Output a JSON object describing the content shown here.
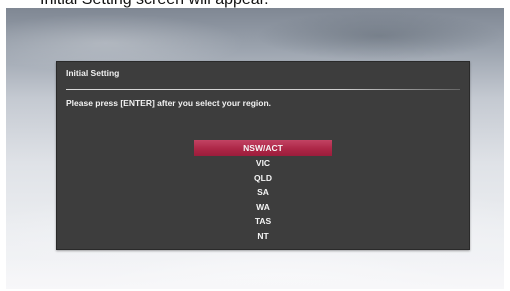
{
  "top_caption": "Initial Setting screen will appear.",
  "dialog": {
    "title": "Initial Setting",
    "instruction": "Please press [ENTER] after you select your region."
  },
  "regions": [
    {
      "label": "NSW/ACT",
      "selected": true
    },
    {
      "label": "VIC",
      "selected": false
    },
    {
      "label": "QLD",
      "selected": false
    },
    {
      "label": "SA",
      "selected": false
    },
    {
      "label": "WA",
      "selected": false
    },
    {
      "label": "TAS",
      "selected": false
    },
    {
      "label": "NT",
      "selected": false
    }
  ],
  "colors": {
    "dialog_background": "#3d3d3d",
    "selection_highlight": "#ad2747",
    "text": "#f5f5f5"
  }
}
